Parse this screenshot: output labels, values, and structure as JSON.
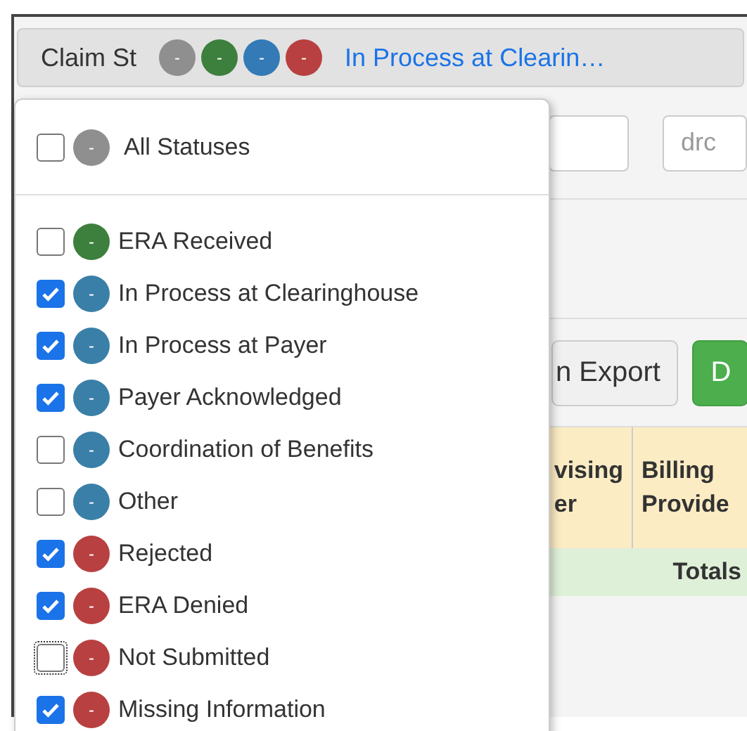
{
  "filter_button": {
    "label": "Claim St",
    "chips": [
      {
        "text": "-",
        "color": "#8f8f8f"
      },
      {
        "text": "-",
        "color": "#3d7f3d"
      },
      {
        "text": "-",
        "color": "#337ab7"
      },
      {
        "text": "-",
        "color": "#b94040"
      }
    ],
    "summary": "In Process at Clearin…"
  },
  "dropdown": {
    "all": {
      "label": "All Statuses",
      "checked": false,
      "badge": "-",
      "color": "#8f8f8f"
    },
    "items": [
      {
        "label": "ERA Received",
        "checked": false,
        "focused": false,
        "badge": "-",
        "color": "#3d7f3d"
      },
      {
        "label": "In Process at Clearinghouse",
        "checked": true,
        "focused": false,
        "badge": "-",
        "color": "#3a7fa8"
      },
      {
        "label": "In Process at Payer",
        "checked": true,
        "focused": false,
        "badge": "-",
        "color": "#3a7fa8"
      },
      {
        "label": "Payer Acknowledged",
        "checked": true,
        "focused": false,
        "badge": "-",
        "color": "#3a7fa8"
      },
      {
        "label": "Coordination of Benefits",
        "checked": false,
        "focused": false,
        "badge": "-",
        "color": "#3a7fa8"
      },
      {
        "label": "Other",
        "checked": false,
        "focused": false,
        "badge": "-",
        "color": "#3a7fa8"
      },
      {
        "label": "Rejected",
        "checked": true,
        "focused": false,
        "badge": "-",
        "color": "#b94040"
      },
      {
        "label": "ERA Denied",
        "checked": true,
        "focused": false,
        "badge": "-",
        "color": "#b94040"
      },
      {
        "label": "Not Submitted",
        "checked": false,
        "focused": true,
        "badge": "-",
        "color": "#b94040"
      },
      {
        "label": "Missing Information",
        "checked": true,
        "focused": false,
        "badge": "-",
        "color": "#b94040"
      }
    ]
  },
  "search_field": {
    "placeholder": "drc"
  },
  "buttons": [
    {
      "label": "n Export",
      "kind": "default"
    },
    {
      "label": "D",
      "kind": "success"
    }
  ],
  "table": {
    "columns": [
      "vising\ner",
      "Billing\nProvide"
    ],
    "totals_label": "Totals"
  }
}
